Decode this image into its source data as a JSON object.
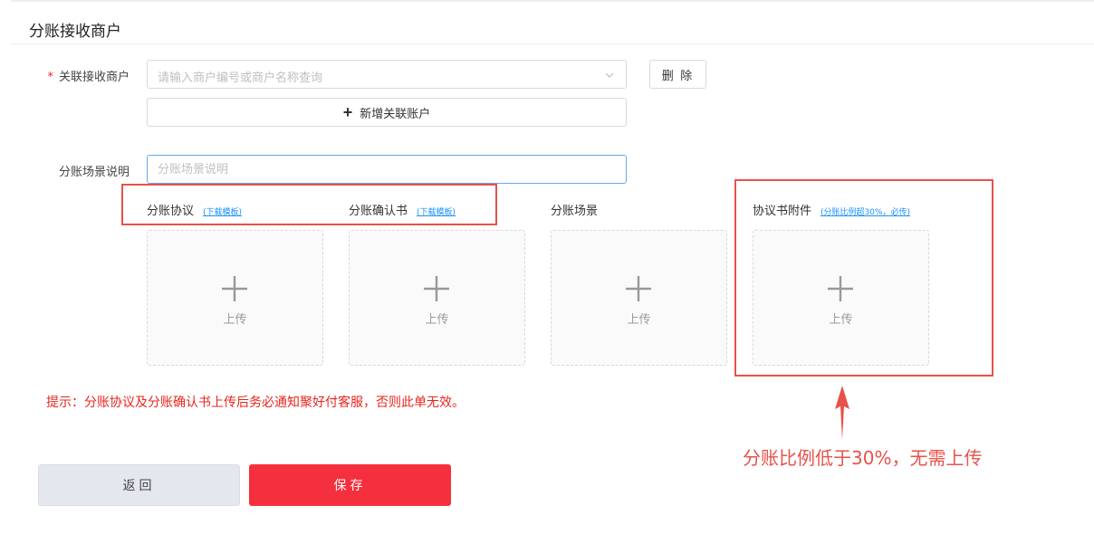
{
  "page": {
    "title": "分账接收商户"
  },
  "merchant": {
    "label": "关联接收商户",
    "required_mark": "*",
    "placeholder": "请输入商户编号或商户名称查询",
    "delete_label": "删 除",
    "add_label": "新增关联账户"
  },
  "scene": {
    "label": "分账场景说明",
    "placeholder": "分账场景说明"
  },
  "uploads": [
    {
      "title": "分账协议",
      "link": "(下载模板)",
      "button_label": "上传"
    },
    {
      "title": "分账确认书",
      "link": "(下载模板)",
      "button_label": "上传"
    },
    {
      "title": "分账场景",
      "link": "",
      "button_label": "上传"
    },
    {
      "title": "协议书附件",
      "link": "(分账比例超30%，必传)",
      "button_label": "上传"
    }
  ],
  "tip": "提示：分账协议及分账确认书上传后务必通知聚好付客服，否则此单无效。",
  "annotation": "分账比例低于30%，无需上传",
  "footer": {
    "back_label": "返回",
    "save_label": "保存"
  },
  "colors": {
    "primary": "#f5303e",
    "annotation": "#e8514a",
    "link": "#1890ff"
  }
}
